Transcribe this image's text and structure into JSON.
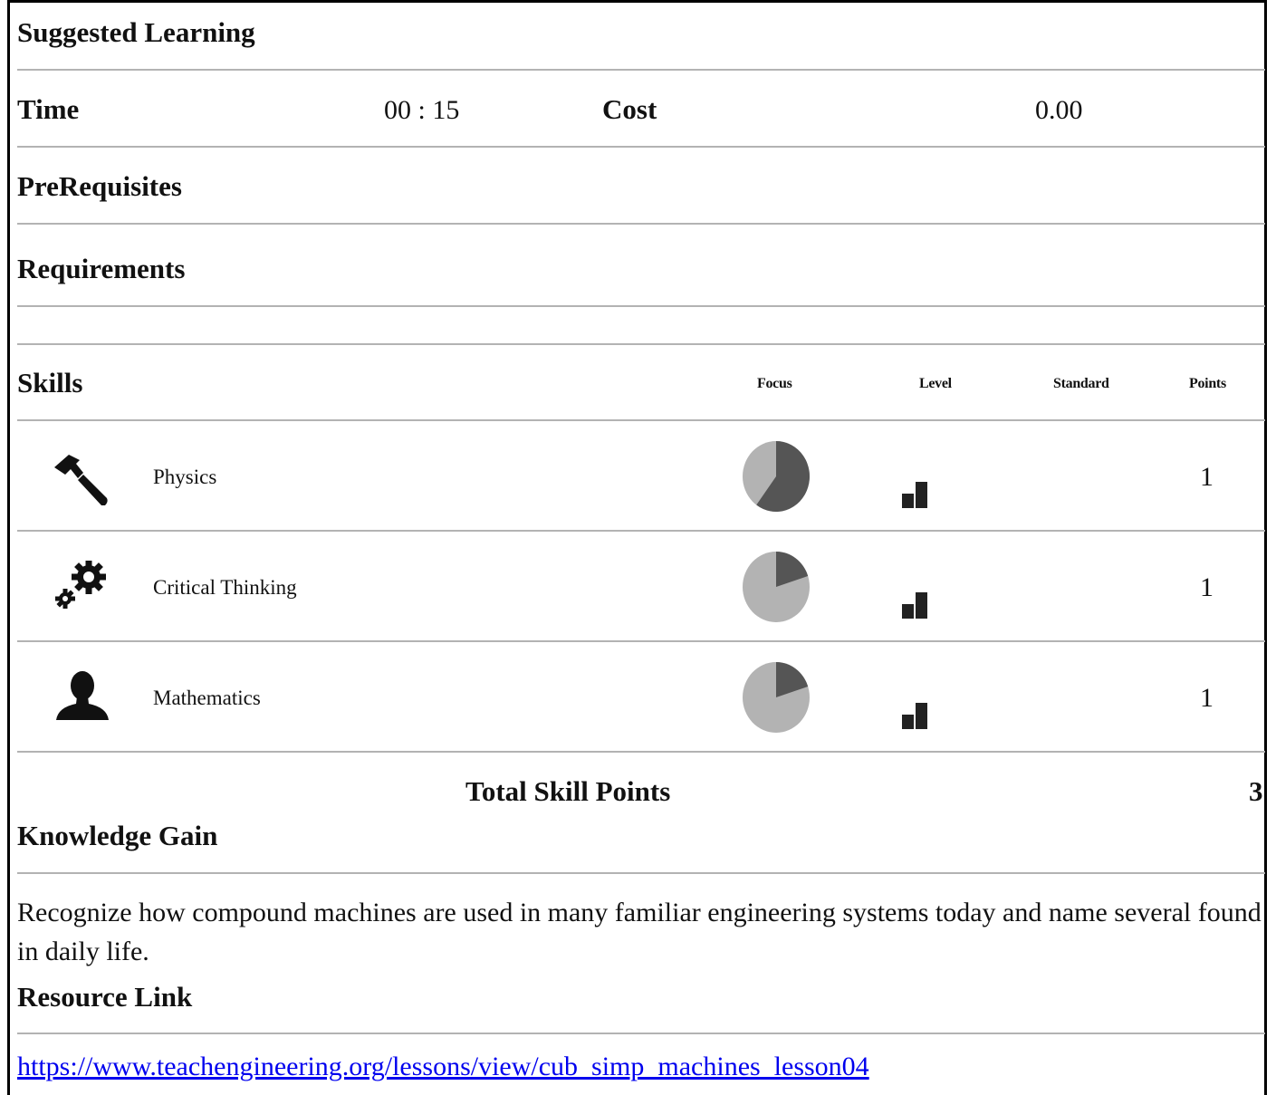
{
  "suggested_learning": {
    "title": "Suggested Learning"
  },
  "time": {
    "label": "Time",
    "value": "00 : 15"
  },
  "cost": {
    "label": "Cost",
    "value": "0.00"
  },
  "prerequisites": {
    "title": "PreRequisites"
  },
  "requirements": {
    "title": "Requirements"
  },
  "skills": {
    "title": "Skills",
    "columns": {
      "focus": "Focus",
      "level": "Level",
      "standard": "Standard",
      "points": "Points"
    },
    "items": [
      {
        "name": "Physics",
        "icon": "hammer-icon",
        "focus_fraction": 0.6,
        "points": "1"
      },
      {
        "name": "Critical Thinking",
        "icon": "gears-icon",
        "focus_fraction": 0.2,
        "points": "1"
      },
      {
        "name": "Mathematics",
        "icon": "person-icon",
        "focus_fraction": 0.2,
        "points": "1"
      }
    ],
    "total_label": "Total Skill Points",
    "total_value": "3"
  },
  "knowledge_gain": {
    "title": "Knowledge Gain",
    "text": "Recognize how compound machines are used in many familiar engineering systems today and name several found in daily life."
  },
  "resource_link": {
    "title": "Resource Link",
    "url": "https://www.teachengineering.org/lessons/view/cub_simp_machines_lesson04"
  },
  "colors": {
    "pie_dark": "#555555",
    "pie_light": "#b3b3b3",
    "rule": "#b3b3b3",
    "level_bars": "#222222"
  }
}
